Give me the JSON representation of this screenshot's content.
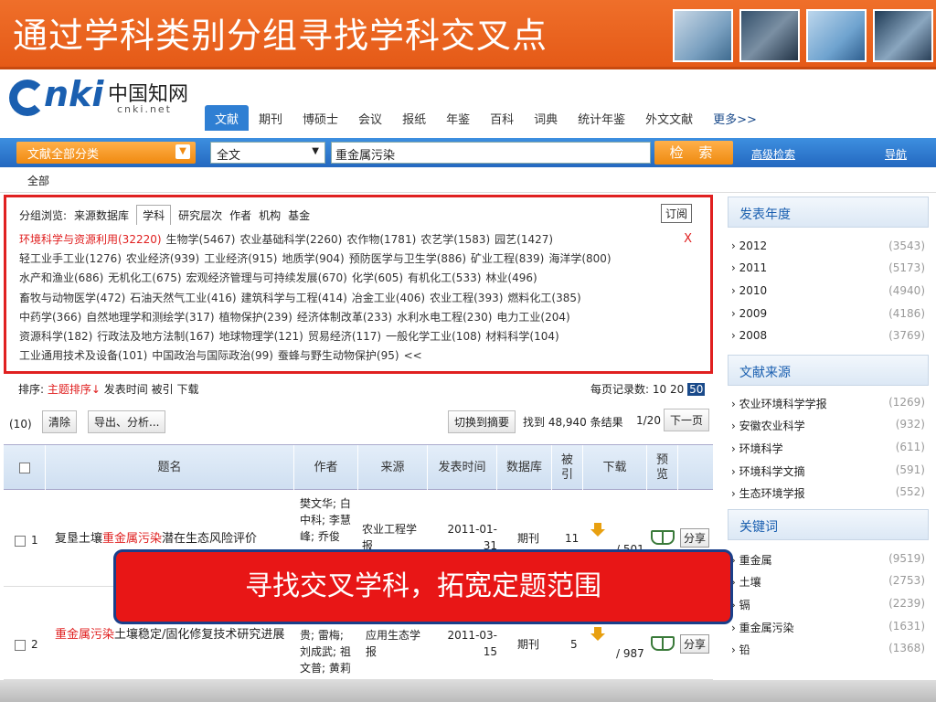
{
  "slide_title": "通过学科类别分组寻找学科交叉点",
  "logo": {
    "brand": "nki",
    "chinese": "中国知网",
    "url": "cnki.net"
  },
  "tabs": [
    "文献",
    "期刊",
    "博硕士",
    "会议",
    "报纸",
    "年鉴",
    "百科",
    "词典",
    "统计年鉴",
    "外文文献",
    "更多>>"
  ],
  "search": {
    "category": "文献全部分类",
    "scope": "全文",
    "query": "重金属污染",
    "button": "检 索",
    "advanced": "高级检索",
    "nav": "导航"
  },
  "all_label": "全部",
  "group": {
    "browse_label": "分组浏览:",
    "options": [
      "来源数据库",
      "学科",
      "研究层次",
      "作者",
      "机构",
      "基金"
    ],
    "subscribe": "订阅",
    "close": "X",
    "items": [
      "环境科学与资源利用(32220)",
      "生物学(5467)",
      "农业基础科学(2260)",
      "农作物(1781)",
      "农艺学(1583)",
      "园艺(1427)",
      "轻工业手工业(1276)",
      "农业经济(939)",
      "工业经济(915)",
      "地质学(904)",
      "预防医学与卫生学(886)",
      "矿业工程(839)",
      "海洋学(800)",
      "水产和渔业(686)",
      "无机化工(675)",
      "宏观经济管理与可持续发展(670)",
      "化学(605)",
      "有机化工(533)",
      "林业(496)",
      "畜牧与动物医学(472)",
      "石油天然气工业(416)",
      "建筑科学与工程(414)",
      "冶金工业(406)",
      "农业工程(393)",
      "燃料化工(385)",
      "中药学(366)",
      "自然地理学和测绘学(317)",
      "植物保护(239)",
      "经济体制改革(233)",
      "水利水电工程(230)",
      "电力工业(204)",
      "资源科学(182)",
      "行政法及地方法制(167)",
      "地球物理学(121)",
      "贸易经济(117)",
      "一般化学工业(108)",
      "材料科学(104)",
      "工业通用技术及设备(101)",
      "中国政治与国际政治(99)",
      "蚕蜂与野生动物保护(95)",
      "<<"
    ]
  },
  "sort": {
    "label": "排序:",
    "options": [
      "主题排序↓",
      "发表时间",
      "被引",
      "下载"
    ],
    "perpage_label": "每页记录数:",
    "perpage": [
      "10",
      "20",
      "50"
    ]
  },
  "tools": {
    "count": "(10)",
    "clear": "清除",
    "export": "导出、分析...",
    "switch": "切换到摘要",
    "found": "找到 48,940 条结果",
    "page": "1/20",
    "next": "下一页"
  },
  "table": {
    "headers": [
      "题名",
      "作者",
      "来源",
      "发表时间",
      "数据库",
      "被引",
      "下载",
      "预览"
    ],
    "rows": [
      {
        "num": "1",
        "title_pre": "复垦土壤",
        "title_kw": "重金属污染",
        "title_post": "潜在生态风险评价",
        "authors": "樊文华; 白中科; 李慧峰; 乔俊",
        "source": "农业工程学报",
        "date": "2011-01-31",
        "db": "期刊",
        "cited": "11",
        "downloads": "/ 501",
        "share": "分享"
      },
      {
        "num": "2",
        "title_pre": "",
        "title_kw": "重金属污染",
        "title_post": "土壤稳定/固化修复技术研究进展",
        "authors": "贵; 雷梅; 刘成武; 祖文普; 黄莉",
        "source": "应用生态学报",
        "date": "2011-03-15",
        "db": "期刊",
        "cited": "5",
        "downloads": "/ 987",
        "share": "分享"
      }
    ]
  },
  "callout": "寻找交叉学科，拓宽定题范围",
  "sidebar": {
    "years": {
      "title": "发表年度",
      "items": [
        {
          "n": "2012",
          "c": "(3543)"
        },
        {
          "n": "2011",
          "c": "(5173)"
        },
        {
          "n": "2010",
          "c": "(4940)"
        },
        {
          "n": "2009",
          "c": "(4186)"
        },
        {
          "n": "2008",
          "c": "(3769)"
        }
      ]
    },
    "sources": {
      "title": "文献来源",
      "items": [
        {
          "n": "农业环境科学学报",
          "c": "(1269)"
        },
        {
          "n": "安徽农业科学",
          "c": "(932)"
        },
        {
          "n": "环境科学",
          "c": "(611)"
        },
        {
          "n": "环境科学文摘",
          "c": "(591)"
        },
        {
          "n": "生态环境学报",
          "c": "(552)"
        }
      ]
    },
    "keywords": {
      "title": "关键词",
      "items": [
        {
          "n": "重金属",
          "c": "(9519)"
        },
        {
          "n": "土壤",
          "c": "(2753)"
        },
        {
          "n": "镉",
          "c": "(2239)"
        },
        {
          "n": "重金属污染",
          "c": "(1631)"
        },
        {
          "n": "铅",
          "c": "(1368)"
        }
      ]
    }
  },
  "colors": {
    "banner": "#e55a17",
    "accent_blue": "#2468c0",
    "highlight_red": "#e02020"
  }
}
